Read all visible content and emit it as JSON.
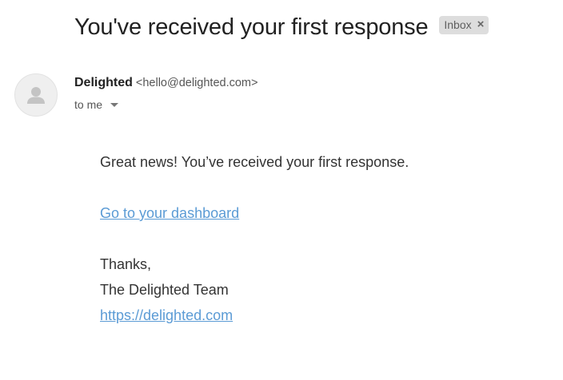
{
  "email": {
    "subject": "You've received your first response",
    "label": "Inbox",
    "label_remove_glyph": "×",
    "sender": {
      "name": "Delighted",
      "email": "<hello@delighted.com>"
    },
    "recipient": "to me",
    "avatar_icon": "default-person-avatar",
    "body": {
      "intro": "Great news! You’ve received your first response.",
      "dashboard_link": "Go to your dashboard",
      "sign_off": "Thanks,",
      "signature": "The Delighted Team",
      "website_link": "https://delighted.com"
    }
  },
  "colors": {
    "link": "#5b9bd5",
    "chip_background": "#dddddd",
    "text": "#333333"
  }
}
